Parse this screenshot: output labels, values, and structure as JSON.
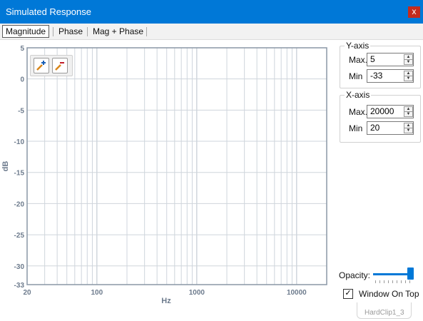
{
  "window": {
    "title": "Simulated Response",
    "close_label": "x"
  },
  "tabs": [
    {
      "label": "Magnitude",
      "active": true
    },
    {
      "label": "Phase",
      "active": false
    },
    {
      "label": "Mag + Phase",
      "active": false
    }
  ],
  "zoom": {
    "in_icon": "zoom-in-icon",
    "out_icon": "zoom-out-icon"
  },
  "yaxis_panel": {
    "title": "Y-axis",
    "max_label": "Max.",
    "max_value": "5",
    "min_label": "Min",
    "min_value": "-33"
  },
  "xaxis_panel": {
    "title": "X-axis",
    "max_label": "Max.",
    "max_value": "20000",
    "min_label": "Min",
    "min_value": "20"
  },
  "opacity": {
    "label": "Opacity:",
    "value": 1.0
  },
  "window_on_top": {
    "label": "Window On Top",
    "checked": true
  },
  "status": {
    "text": "HardClip1_3"
  },
  "colors": {
    "titlebar": "#0078d7",
    "axis_text": "#6d7b8d",
    "grid": "#cfd5dc",
    "frame": "#8a97a6"
  },
  "chart_data": {
    "type": "line",
    "xlabel": "Hz",
    "ylabel": "dB",
    "x_scale": "log",
    "xlim": [
      20,
      20000
    ],
    "ylim": [
      -33,
      5
    ],
    "x_ticks": [
      {
        "value": 20,
        "label": "20"
      },
      {
        "value": 100,
        "label": "100"
      },
      {
        "value": 1000,
        "label": "1000"
      },
      {
        "value": 10000,
        "label": "10000"
      }
    ],
    "y_ticks": [
      {
        "value": 5,
        "label": "5"
      },
      {
        "value": 0,
        "label": "0"
      },
      {
        "value": -5,
        "label": "-5"
      },
      {
        "value": -10,
        "label": "-10"
      },
      {
        "value": -15,
        "label": "-15"
      },
      {
        "value": -20,
        "label": "-20"
      },
      {
        "value": -25,
        "label": "-25"
      },
      {
        "value": -30,
        "label": "-30"
      },
      {
        "value": -33,
        "label": "-33"
      }
    ],
    "grid": true,
    "series": []
  }
}
